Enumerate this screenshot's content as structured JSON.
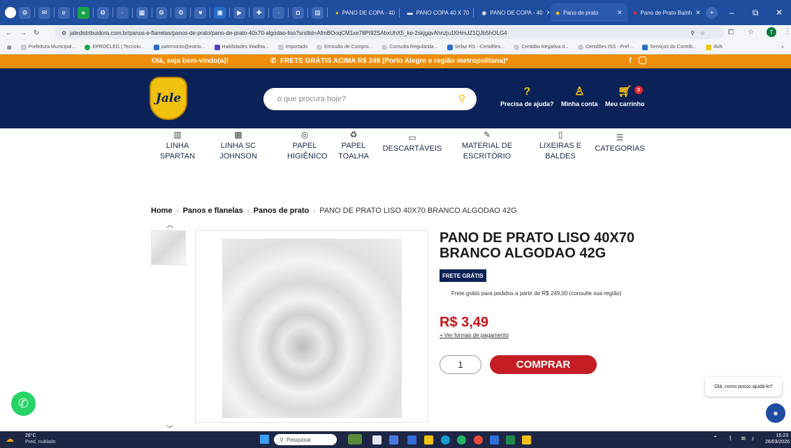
{
  "browser": {
    "tabs": [
      {
        "label": "PANO DE COPA - 40"
      },
      {
        "label": "PANO COPA 40 X 70"
      },
      {
        "label": "PANO DE COPA - 40"
      },
      {
        "label": "Pano de prato"
      },
      {
        "label": "Pano de Prato Bainh"
      }
    ],
    "url": "jaledistribuidora.com.br/panos-e-flanelas/panos-de-prato/pano-de-prato-40x70-algodao-liso?srsltid=AfmBOoqCM1xe78PI92SAbxUhX5_ke-2skjgqvAhnzju1KHmJZ1QJb5hOLG4",
    "bookmarks": [
      "Prefeitura Municipal...",
      "EPROCLEG | Tecnolo...",
      "patrimonio@estrio...",
      "Habilidades Wadhw...",
      "Importado",
      "Emissão de Compro...",
      "Consulta Regularida...",
      "Sefaz RS - Certidões...",
      "Certidão Negativa d...",
      "Certidões ISS - Pref...",
      "Serviços do Contrib...",
      "AVA"
    ]
  },
  "promo": {
    "welcome": "Olá, seja bem-vindo(a)!",
    "shipping": "FRETE GRÁTIS ACIMA R$ 249 (Porto Alegre e região metropolitana)*"
  },
  "header": {
    "logo": "Jale",
    "search_placeholder": "o que procura hoje?",
    "help": "Precisa de ajuda?",
    "account": "Minha conta",
    "cart": "Meu carrinho",
    "cart_count": "0"
  },
  "categories": [
    {
      "line1": "LINHA",
      "line2": "SPARTAN"
    },
    {
      "line1": "LINHA SC",
      "line2": "JOHNSON"
    },
    {
      "line1": "PAPEL",
      "line2": "HIGIÊNICO"
    },
    {
      "line1": "PAPEL",
      "line2": "TOALHA"
    },
    {
      "line1": "DESCARTÁVEIS",
      "line2": ""
    },
    {
      "line1": "MATERIAL DE",
      "line2": "ESCRITÓRIO"
    },
    {
      "line1": "LIXEIRAS E",
      "line2": "BALDES"
    },
    {
      "line1": "CATEGORIAS",
      "line2": ""
    }
  ],
  "breadcrumb": [
    "Home",
    "Panos e flanelas",
    "Panos de prato",
    "PANO DE PRATO LISO 40X70 BRANCO ALGODAO 42G"
  ],
  "product": {
    "title": "PANO DE PRATO LISO 40X70 BRANCO ALGODAO 42G",
    "badge": "FRETE GRÁTIS",
    "shipping_note": "Frete grátis para pedidos a partir de R$ 249,00 (consulte sua região)",
    "price": "R$ 3,49",
    "payment_link": "+ Ver formas de pagamento",
    "quantity": "1",
    "buy": "COMPRAR"
  },
  "chat": {
    "greeting": "Olá, como posso ajudá-lo?"
  },
  "taskbar": {
    "weather_temp": "28°C",
    "weather_desc": "Pred. nublado",
    "search": "Pesquisar",
    "time": "15:23",
    "date": "26/03/2026"
  },
  "colors": {
    "navy": "#0b2258",
    "orange": "#ef8e0b",
    "red": "#c41e24",
    "yellow": "#f1c10f"
  }
}
